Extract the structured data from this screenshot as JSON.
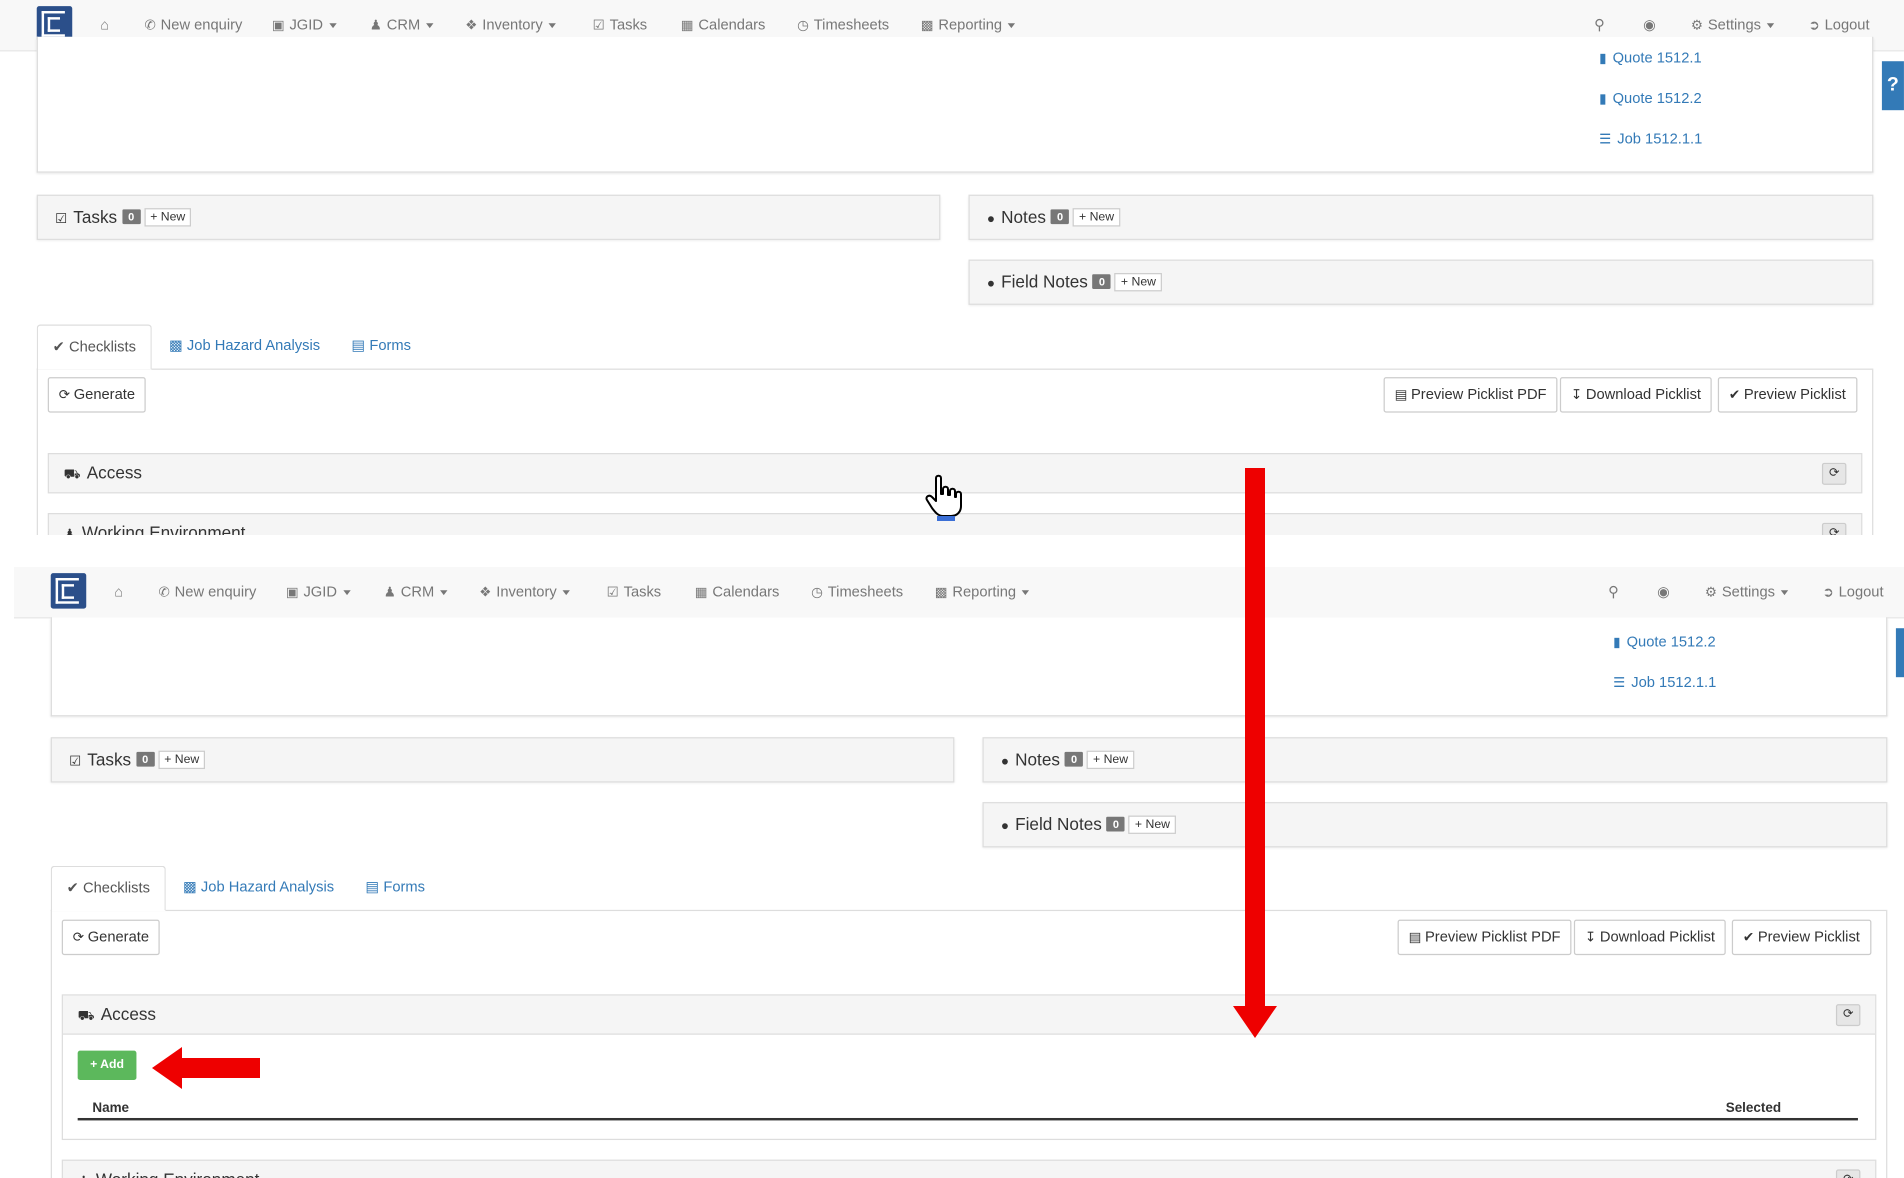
{
  "nav": {
    "home_icon": "home-icon",
    "new_enquiry": "New enquiry",
    "jgid": "JGID",
    "crm": "CRM",
    "inventory": "Inventory",
    "tasks": "Tasks",
    "calendars": "Calendars",
    "timesheets": "Timesheets",
    "reporting": "Reporting",
    "settings": "Settings",
    "logout": "Logout"
  },
  "top": {
    "links": [
      "Quote 1512.1",
      "Quote 1512.2",
      "Job 1512.1.1"
    ]
  },
  "bottom": {
    "links": [
      "Quote 1512.2",
      "Job 1512.1.1"
    ]
  },
  "panels": {
    "tasks_title": "Tasks",
    "tasks_count": "0",
    "notes_title": "Notes",
    "notes_count": "0",
    "field_notes_title": "Field Notes",
    "field_notes_count": "0",
    "new_label": "New"
  },
  "tabs": {
    "checklists": "Checklists",
    "jha": "Job Hazard Analysis",
    "forms": "Forms"
  },
  "toolbar": {
    "generate": "Generate",
    "preview_pdf": "Preview Picklist PDF",
    "download": "Download Picklist",
    "preview": "Preview Picklist"
  },
  "checklist": {
    "access": "Access",
    "working_env": "Working Environment",
    "add": "Add",
    "col_name": "Name",
    "col_selected": "Selected"
  },
  "colors": {
    "accent": "#337ab7",
    "add_green": "#5cb85c",
    "arrow_red": "#ee0000",
    "logo_blue": "#2b4f8a"
  }
}
